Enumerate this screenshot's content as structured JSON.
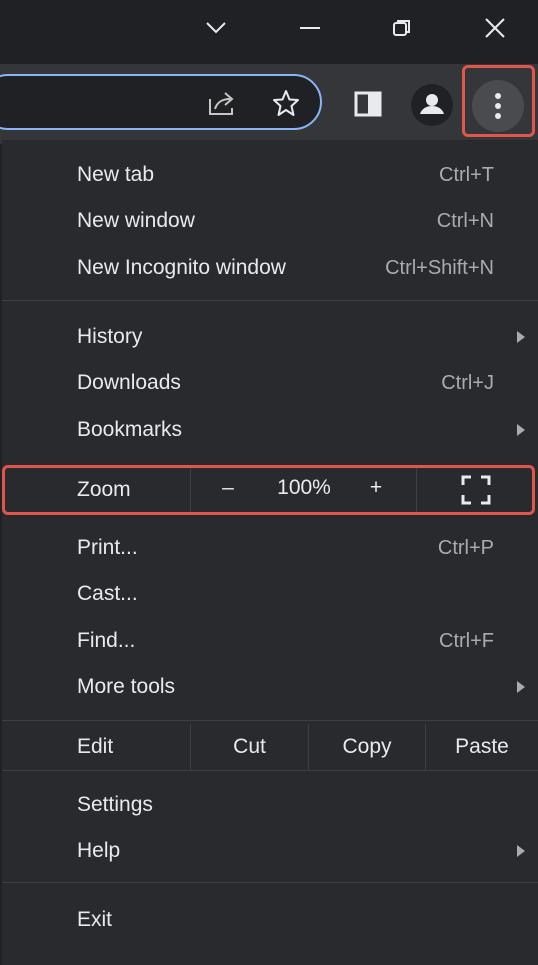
{
  "titlebar": {
    "buttons": [
      "tab-search",
      "minimize",
      "restore",
      "close"
    ]
  },
  "toolbar": {
    "icons": [
      "share-icon",
      "bookmark-star-icon",
      "side-panel-icon",
      "profile-icon",
      "more-menu-icon"
    ]
  },
  "menu": {
    "group1": [
      {
        "label": "New tab",
        "shortcut": "Ctrl+T"
      },
      {
        "label": "New window",
        "shortcut": "Ctrl+N"
      },
      {
        "label": "New Incognito window",
        "shortcut": "Ctrl+Shift+N"
      }
    ],
    "group2": [
      {
        "label": "History",
        "shortcut": ""
      },
      {
        "label": "Downloads",
        "shortcut": "Ctrl+J"
      },
      {
        "label": "Bookmarks",
        "shortcut": ""
      }
    ],
    "zoom": {
      "label": "Zoom",
      "minus": "–",
      "value": "100%",
      "plus": "+"
    },
    "group3": [
      {
        "label": "Print...",
        "shortcut": "Ctrl+P"
      },
      {
        "label": "Cast...",
        "shortcut": ""
      },
      {
        "label": "Find...",
        "shortcut": "Ctrl+F"
      },
      {
        "label": "More tools",
        "shortcut": ""
      }
    ],
    "edit": {
      "label": "Edit",
      "cut": "Cut",
      "copy": "Copy",
      "paste": "Paste"
    },
    "group4": [
      {
        "label": "Settings"
      },
      {
        "label": "Help"
      }
    ],
    "exit": "Exit"
  },
  "colors": {
    "highlight": "#e0564a",
    "focus_ring": "#8ab4f8",
    "menu_bg": "#292a2d"
  }
}
